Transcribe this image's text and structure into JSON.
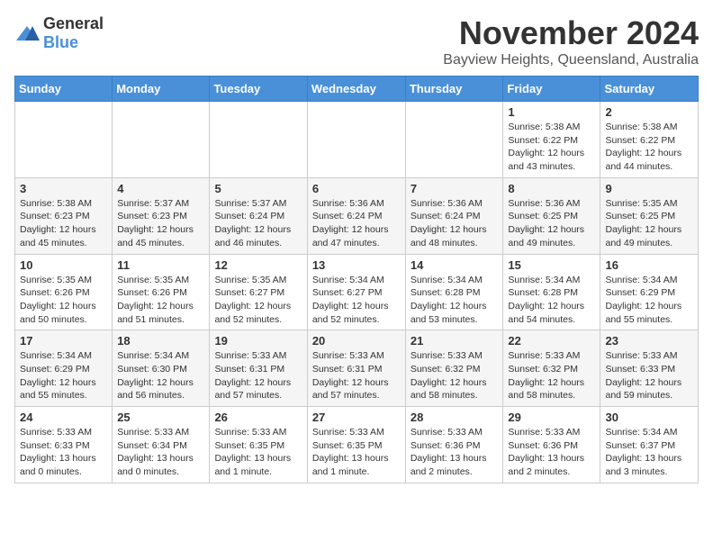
{
  "logo": {
    "general": "General",
    "blue": "Blue"
  },
  "title": {
    "month": "November 2024",
    "location": "Bayview Heights, Queensland, Australia"
  },
  "weekdays": [
    "Sunday",
    "Monday",
    "Tuesday",
    "Wednesday",
    "Thursday",
    "Friday",
    "Saturday"
  ],
  "weeks": [
    [
      {
        "day": "",
        "info": ""
      },
      {
        "day": "",
        "info": ""
      },
      {
        "day": "",
        "info": ""
      },
      {
        "day": "",
        "info": ""
      },
      {
        "day": "",
        "info": ""
      },
      {
        "day": "1",
        "info": "Sunrise: 5:38 AM\nSunset: 6:22 PM\nDaylight: 12 hours\nand 43 minutes."
      },
      {
        "day": "2",
        "info": "Sunrise: 5:38 AM\nSunset: 6:22 PM\nDaylight: 12 hours\nand 44 minutes."
      }
    ],
    [
      {
        "day": "3",
        "info": "Sunrise: 5:38 AM\nSunset: 6:23 PM\nDaylight: 12 hours\nand 45 minutes."
      },
      {
        "day": "4",
        "info": "Sunrise: 5:37 AM\nSunset: 6:23 PM\nDaylight: 12 hours\nand 45 minutes."
      },
      {
        "day": "5",
        "info": "Sunrise: 5:37 AM\nSunset: 6:24 PM\nDaylight: 12 hours\nand 46 minutes."
      },
      {
        "day": "6",
        "info": "Sunrise: 5:36 AM\nSunset: 6:24 PM\nDaylight: 12 hours\nand 47 minutes."
      },
      {
        "day": "7",
        "info": "Sunrise: 5:36 AM\nSunset: 6:24 PM\nDaylight: 12 hours\nand 48 minutes."
      },
      {
        "day": "8",
        "info": "Sunrise: 5:36 AM\nSunset: 6:25 PM\nDaylight: 12 hours\nand 49 minutes."
      },
      {
        "day": "9",
        "info": "Sunrise: 5:35 AM\nSunset: 6:25 PM\nDaylight: 12 hours\nand 49 minutes."
      }
    ],
    [
      {
        "day": "10",
        "info": "Sunrise: 5:35 AM\nSunset: 6:26 PM\nDaylight: 12 hours\nand 50 minutes."
      },
      {
        "day": "11",
        "info": "Sunrise: 5:35 AM\nSunset: 6:26 PM\nDaylight: 12 hours\nand 51 minutes."
      },
      {
        "day": "12",
        "info": "Sunrise: 5:35 AM\nSunset: 6:27 PM\nDaylight: 12 hours\nand 52 minutes."
      },
      {
        "day": "13",
        "info": "Sunrise: 5:34 AM\nSunset: 6:27 PM\nDaylight: 12 hours\nand 52 minutes."
      },
      {
        "day": "14",
        "info": "Sunrise: 5:34 AM\nSunset: 6:28 PM\nDaylight: 12 hours\nand 53 minutes."
      },
      {
        "day": "15",
        "info": "Sunrise: 5:34 AM\nSunset: 6:28 PM\nDaylight: 12 hours\nand 54 minutes."
      },
      {
        "day": "16",
        "info": "Sunrise: 5:34 AM\nSunset: 6:29 PM\nDaylight: 12 hours\nand 55 minutes."
      }
    ],
    [
      {
        "day": "17",
        "info": "Sunrise: 5:34 AM\nSunset: 6:29 PM\nDaylight: 12 hours\nand 55 minutes."
      },
      {
        "day": "18",
        "info": "Sunrise: 5:34 AM\nSunset: 6:30 PM\nDaylight: 12 hours\nand 56 minutes."
      },
      {
        "day": "19",
        "info": "Sunrise: 5:33 AM\nSunset: 6:31 PM\nDaylight: 12 hours\nand 57 minutes."
      },
      {
        "day": "20",
        "info": "Sunrise: 5:33 AM\nSunset: 6:31 PM\nDaylight: 12 hours\nand 57 minutes."
      },
      {
        "day": "21",
        "info": "Sunrise: 5:33 AM\nSunset: 6:32 PM\nDaylight: 12 hours\nand 58 minutes."
      },
      {
        "day": "22",
        "info": "Sunrise: 5:33 AM\nSunset: 6:32 PM\nDaylight: 12 hours\nand 58 minutes."
      },
      {
        "day": "23",
        "info": "Sunrise: 5:33 AM\nSunset: 6:33 PM\nDaylight: 12 hours\nand 59 minutes."
      }
    ],
    [
      {
        "day": "24",
        "info": "Sunrise: 5:33 AM\nSunset: 6:33 PM\nDaylight: 13 hours\nand 0 minutes."
      },
      {
        "day": "25",
        "info": "Sunrise: 5:33 AM\nSunset: 6:34 PM\nDaylight: 13 hours\nand 0 minutes."
      },
      {
        "day": "26",
        "info": "Sunrise: 5:33 AM\nSunset: 6:35 PM\nDaylight: 13 hours\nand 1 minute."
      },
      {
        "day": "27",
        "info": "Sunrise: 5:33 AM\nSunset: 6:35 PM\nDaylight: 13 hours\nand 1 minute."
      },
      {
        "day": "28",
        "info": "Sunrise: 5:33 AM\nSunset: 6:36 PM\nDaylight: 13 hours\nand 2 minutes."
      },
      {
        "day": "29",
        "info": "Sunrise: 5:33 AM\nSunset: 6:36 PM\nDaylight: 13 hours\nand 2 minutes."
      },
      {
        "day": "30",
        "info": "Sunrise: 5:34 AM\nSunset: 6:37 PM\nDaylight: 13 hours\nand 3 minutes."
      }
    ]
  ]
}
